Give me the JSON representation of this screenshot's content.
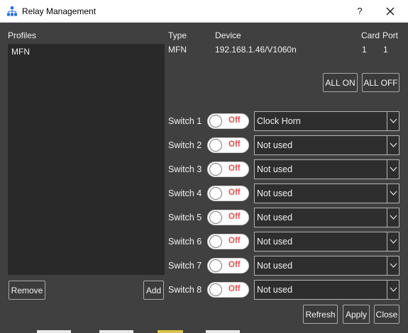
{
  "window": {
    "title": "Relay Management",
    "icon": "network-tree-icon",
    "help_label": "?",
    "close_label": "✕"
  },
  "profiles": {
    "heading": "Profiles",
    "items": [
      "MFN"
    ],
    "remove_label": "Remove",
    "add_label": "Add"
  },
  "device_info": {
    "headers": {
      "type": "Type",
      "device": "Device",
      "card": "Card",
      "port": "Port"
    },
    "type": "MFN",
    "device": "192.168.1.46/V1060n",
    "card": "1",
    "port": "1"
  },
  "bulk": {
    "all_on_label": "ALL ON",
    "all_off_label": "ALL OFF"
  },
  "switches": [
    {
      "label": "Switch 1",
      "state": "Off",
      "assignment": "Clock Horn"
    },
    {
      "label": "Switch 2",
      "state": "Off",
      "assignment": "Not used"
    },
    {
      "label": "Switch 3",
      "state": "Off",
      "assignment": "Not used"
    },
    {
      "label": "Switch 4",
      "state": "Off",
      "assignment": "Not used"
    },
    {
      "label": "Switch 5",
      "state": "Off",
      "assignment": "Not used"
    },
    {
      "label": "Switch 6",
      "state": "Off",
      "assignment": "Not used"
    },
    {
      "label": "Switch 7",
      "state": "Off",
      "assignment": "Not used"
    },
    {
      "label": "Switch 8",
      "state": "Off",
      "assignment": "Not used"
    }
  ],
  "footer": {
    "refresh_label": "Refresh",
    "apply_label": "Apply",
    "close_label": "Close"
  },
  "colors": {
    "background": "#404040",
    "panel": "#292929",
    "off_state": "#e0524f",
    "titlebar": "#ffffff"
  }
}
